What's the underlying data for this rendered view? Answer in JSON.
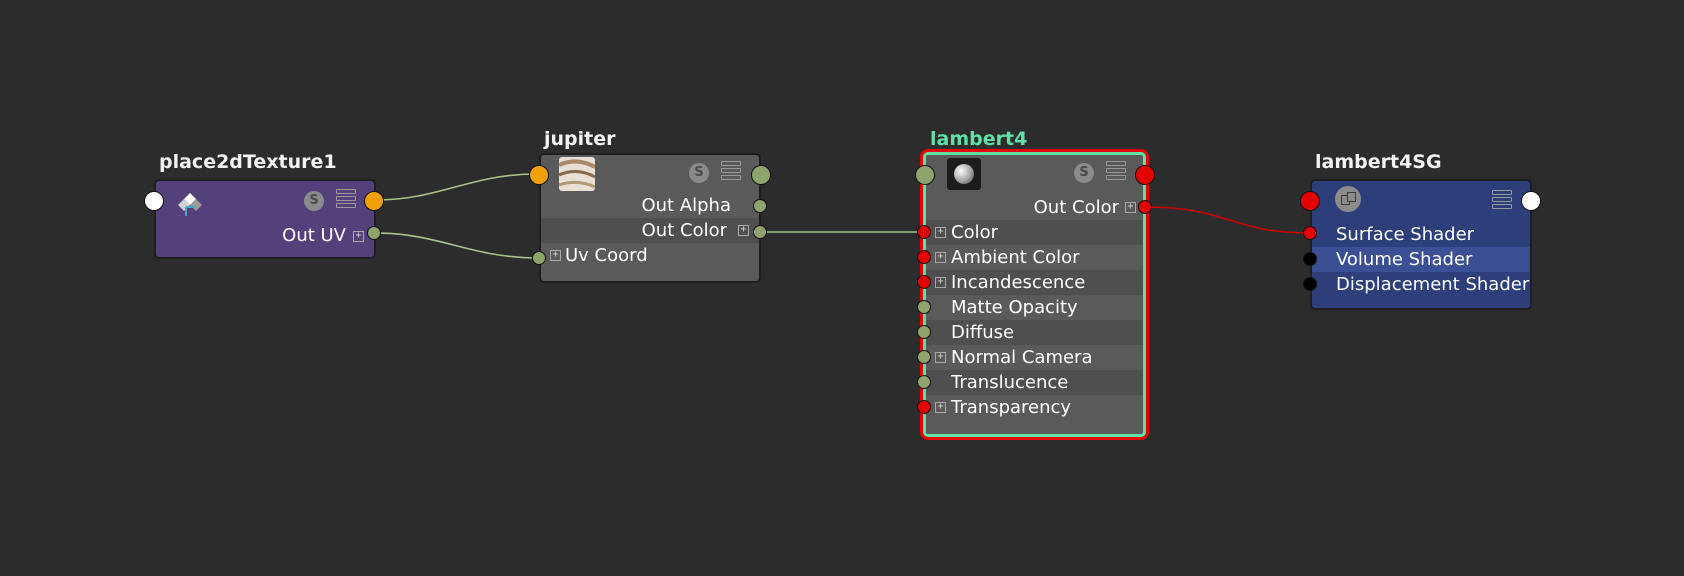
{
  "nodes": {
    "place2d": {
      "title": "place2dTexture1",
      "attrs": [
        {
          "label": "Out UV"
        }
      ],
      "icons": {
        "thumbnail": "place2d-texture-icon",
        "swatch": "swatch-toggle-icon",
        "layout": "attribute-layout-icon"
      }
    },
    "jupiter": {
      "title": "jupiter",
      "attrs": [
        {
          "label": "Out Alpha"
        },
        {
          "label": "Out Color"
        },
        {
          "label": "Uv Coord"
        }
      ],
      "icons": {
        "thumbnail": "file-texture-thumbnail-icon"
      }
    },
    "lambert": {
      "title": "lambert4",
      "out_label": "Out Color",
      "attrs": [
        {
          "label": "Color"
        },
        {
          "label": "Ambient Color"
        },
        {
          "label": "Incandescence"
        },
        {
          "label": "Matte Opacity"
        },
        {
          "label": "Diffuse"
        },
        {
          "label": "Normal Camera"
        },
        {
          "label": "Translucence"
        },
        {
          "label": "Transparency"
        }
      ],
      "icons": {
        "thumbnail": "lambert-material-thumbnail-icon"
      }
    },
    "sg": {
      "title": "lambert4SG",
      "attrs": [
        {
          "label": "Surface Shader"
        },
        {
          "label": "Volume Shader"
        },
        {
          "label": "Displacement Shader"
        }
      ],
      "icons": {
        "thumbnail": "shading-group-icon"
      }
    }
  },
  "swatch_icon_letter": "S",
  "colors": {
    "background": "#2c2c2c",
    "texture_node": "#54407a",
    "shader_node": "#5a5a5a",
    "shading_group_node": "#2c3f7a",
    "selected_title": "#5fe1a6",
    "selection_outline": "#e50000",
    "green_wire": "#a9c48a",
    "red_wire": "#cc0000"
  }
}
